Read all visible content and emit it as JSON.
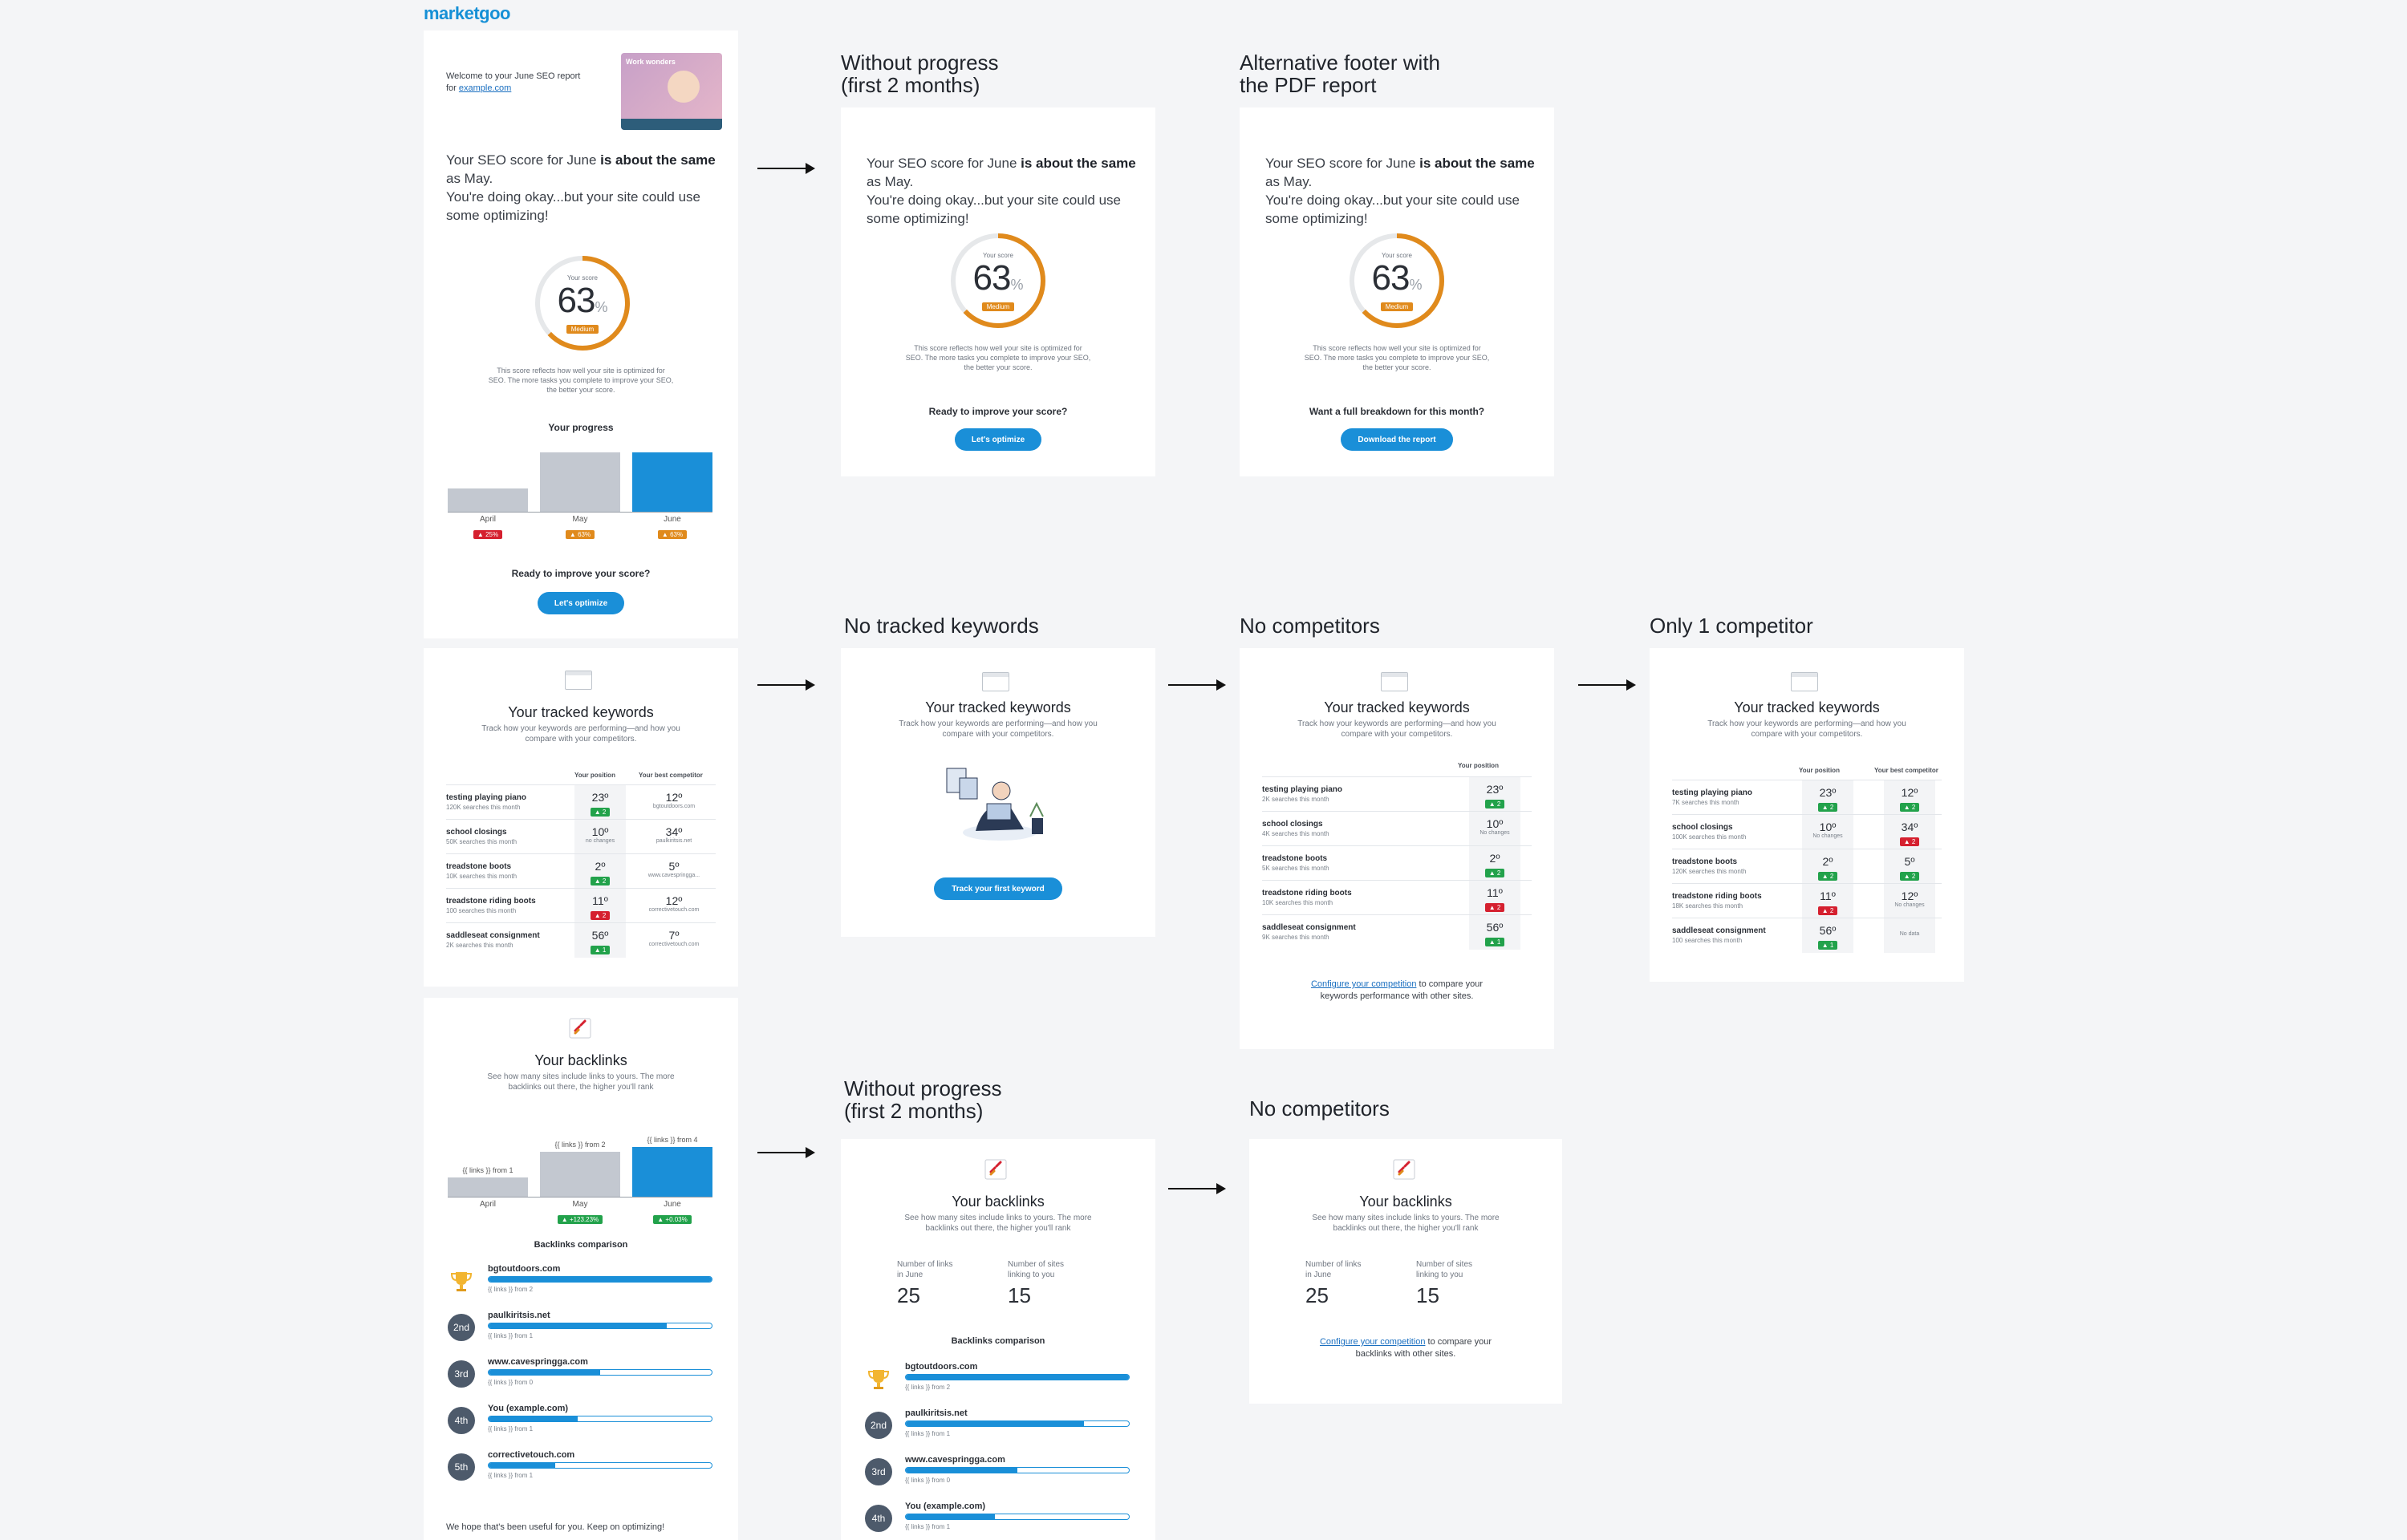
{
  "brand": {
    "logo": "marketgoo",
    "accent": "#1a8fd8"
  },
  "titles": {
    "no_progress_1": "Without progress\n(first 2 months)",
    "alt_footer": "Alternative footer with\nthe PDF report",
    "no_keywords": "No tracked keywords",
    "no_competitors_1": "No competitors",
    "one_competitor": "Only 1 competitor",
    "no_progress_2": "Without progress\n(first 2 months)",
    "no_competitors_2": "No competitors"
  },
  "score": {
    "welcome": "Welcome to your June SEO report for",
    "site": "example.com",
    "hero": "Work wonders",
    "intro_pre": "Your SEO score for June ",
    "intro_bold": "is about the same",
    "intro_post": " as May.\nYou're doing okay...but your site could use some optimizing!",
    "gauge_label": "Your score",
    "value": "63",
    "unit": "%",
    "level": "Medium",
    "note": "This score reflects how well your site is optimized for SEO. The more tasks you complete to improve your SEO, the better your score.",
    "progress_title": "Your progress",
    "improve": "Ready to improve your score?",
    "optimize_btn": "Let's optimize",
    "breakdown": "Want a full breakdown for this month?",
    "download_btn": "Download the report"
  },
  "progress": {
    "months": [
      "April",
      "May",
      "June"
    ],
    "values": [
      25,
      63,
      63
    ],
    "badges": [
      "▲ 25%",
      "▲ 63%",
      "▲ 63%"
    ]
  },
  "keywords": {
    "title": "Your tracked keywords",
    "subtitle": "Track how your keywords are performing—and how you compare with your competitors.",
    "col_position": "Your position",
    "col_competitor": "Your best competitor",
    "track_btn": "Track your first keyword",
    "rows": [
      {
        "name": "testing playing piano",
        "vol": "120K searches this month",
        "pos": "23º",
        "delta": "▲ 2",
        "dclass": "green",
        "comp": "12º",
        "csite": "bgtoutdoors.com"
      },
      {
        "name": "school closings",
        "vol": "50K searches this month",
        "pos": "10º",
        "delta": "no changes",
        "dclass": "none",
        "comp": "34º",
        "csite": "paulkiritsis.net"
      },
      {
        "name": "treadstone boots",
        "vol": "10K searches this month",
        "pos": "2º",
        "delta": "▲ 2",
        "dclass": "green",
        "comp": "5º",
        "csite": "www.cavespringga..."
      },
      {
        "name": "treadstone riding boots",
        "vol": "100 searches this month",
        "pos": "11º",
        "delta": "▲ 2",
        "dclass": "red",
        "comp": "12º",
        "csite": "correctivetouch.com"
      },
      {
        "name": "saddleseat consignment",
        "vol": "2K searches this month",
        "pos": "56º",
        "delta": "▲ 1",
        "dclass": "green",
        "comp": "7º",
        "csite": "correctivetouch.com"
      }
    ],
    "rows_nc": [
      {
        "name": "testing playing piano",
        "vol": "2K searches this month",
        "pos": "23º",
        "delta": "▲ 2",
        "dclass": "green"
      },
      {
        "name": "school closings",
        "vol": "4K searches this month",
        "pos": "10º",
        "delta": "No changes",
        "dclass": "none"
      },
      {
        "name": "treadstone boots",
        "vol": "5K searches this month",
        "pos": "2º",
        "delta": "▲ 2",
        "dclass": "green"
      },
      {
        "name": "treadstone riding boots",
        "vol": "10K searches this month",
        "pos": "11º",
        "delta": "▲ 2",
        "dclass": "red"
      },
      {
        "name": "saddleseat consignment",
        "vol": "9K searches this month",
        "pos": "56º",
        "delta": "▲ 1",
        "dclass": "green"
      }
    ],
    "rows_one": [
      {
        "name": "testing playing piano",
        "vol": "7K searches this month",
        "pos": "23º",
        "delta": "▲ 2",
        "dclass": "green",
        "comp": "12º",
        "cdelta": "▲ 2",
        "cclass": "green"
      },
      {
        "name": "school closings",
        "vol": "100K searches this month",
        "pos": "10º",
        "delta": "No changes",
        "dclass": "none",
        "comp": "34º",
        "cdelta": "▲ 2",
        "cclass": "red"
      },
      {
        "name": "treadstone boots",
        "vol": "120K searches this month",
        "pos": "2º",
        "delta": "▲ 2",
        "dclass": "green",
        "comp": "5º",
        "cdelta": "▲ 2",
        "cclass": "green"
      },
      {
        "name": "treadstone riding boots",
        "vol": "18K searches this month",
        "pos": "11º",
        "delta": "▲ 2",
        "dclass": "red",
        "comp": "12º",
        "cdelta": "No changes",
        "cclass": "none"
      },
      {
        "name": "saddleseat consignment",
        "vol": "100 searches this month",
        "pos": "56º",
        "delta": "▲ 1",
        "dclass": "green",
        "comp": "No data",
        "cdelta": "",
        "cclass": "none"
      }
    ],
    "configure_link": "Configure your competition",
    "configure_rest": " to compare your keywords performance with other sites."
  },
  "backlinks": {
    "title": "Your backlinks",
    "subtitle": "See how many sites include links to yours. The more backlinks out there, the higher you'll rank",
    "bar_labels": [
      "{{ links }} from 1",
      "{{ links }} from 2",
      "{{ links }} from 4"
    ],
    "months": [
      "April",
      "May",
      "June"
    ],
    "values": [
      1,
      2,
      4
    ],
    "badges": [
      "",
      "▲ +123.23%",
      "▲ +0.03%"
    ],
    "comparison_title": "Backlinks comparison",
    "competitors": [
      {
        "rank": "",
        "site": "bgtoutdoors.com",
        "sub": "{{ links }} from 2",
        "pct": 100
      },
      {
        "rank": "2nd",
        "site": "paulkiritsis.net",
        "sub": "{{ links }} from 1",
        "pct": 80
      },
      {
        "rank": "3rd",
        "site": "www.cavespringga.com",
        "sub": "{{ links }} from 0",
        "pct": 50
      },
      {
        "rank": "4th",
        "site": "You (example.com)",
        "sub": "{{ links }} from 1",
        "pct": 40
      },
      {
        "rank": "5th",
        "site": "correctivetouch.com",
        "sub": "{{ links }} from 1",
        "pct": 30
      }
    ],
    "stat1_label": "Number of links\nin June",
    "stat1_value": "25",
    "stat2_label": "Number of sites\nlinking to you",
    "stat2_value": "15",
    "configure_link": "Configure your competition",
    "configure_rest": " to compare your backlinks with other sites.",
    "closing": "We hope that's been useful for you. Keep on optimizing!"
  }
}
